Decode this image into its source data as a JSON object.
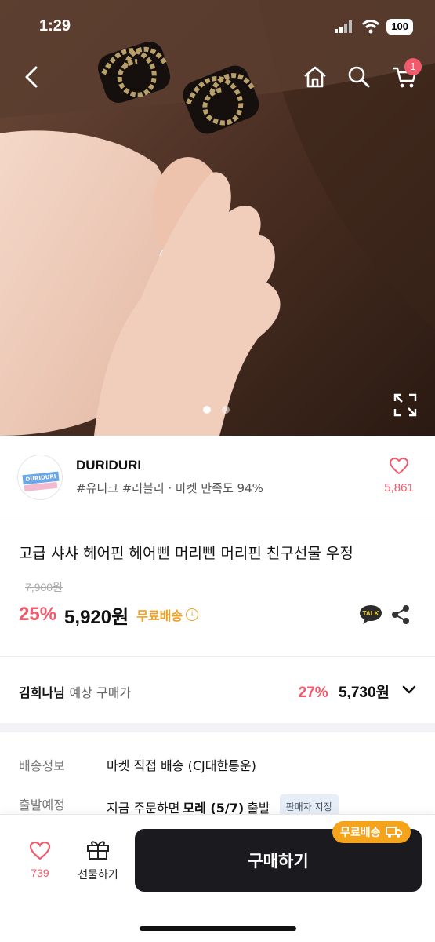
{
  "status_bar": {
    "time": "1:29",
    "battery": "100"
  },
  "nav": {
    "cart_count": "1"
  },
  "gallery": {
    "total": 2,
    "active": 1
  },
  "shop": {
    "logo_text": "DURIDURI",
    "name": "DURIDURI",
    "tags": "#유니크 #러블리 · 마켓 만족도 94%",
    "likes": "5,861"
  },
  "product": {
    "title": "고급 샤샤 헤어핀 헤어삔 머리삔 머리핀 친구선물 우정",
    "original_price": "7,900원",
    "discount": "25%",
    "price": "5,920원",
    "free_shipping": "무료배송",
    "info_icon": "i"
  },
  "member": {
    "name": "김희나님",
    "label": "예상 구매가",
    "discount": "27%",
    "price": "5,730원"
  },
  "info": [
    {
      "label": "배송정보",
      "value": "마켓 직접 배송 (CJ대한통운)"
    },
    {
      "label": "출발예정",
      "value_prefix": "지금 주문하면",
      "value_bold": "모레 (5/7)",
      "value_suffix": "출발",
      "chip": "판매자 지정"
    }
  ],
  "bottom": {
    "likes": "739",
    "gift_label": "선물하기",
    "buy_label": "구매하기",
    "ship_pill": "무료배송"
  },
  "colors": {
    "accent": "#f25a6c",
    "shipping": "#f0a020",
    "button": "#1b1b1f"
  },
  "icons": [
    "back-icon",
    "home-icon",
    "search-icon",
    "cart-icon",
    "expand-icon",
    "heart-icon",
    "info-icon",
    "kakaotalk-icon",
    "share-icon",
    "chevron-down-icon",
    "gift-icon",
    "truck-icon"
  ]
}
